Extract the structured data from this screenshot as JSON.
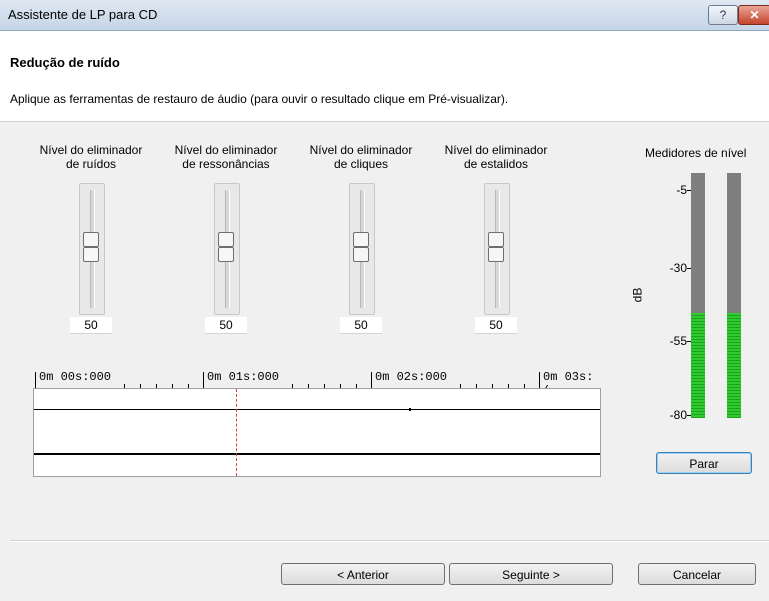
{
  "window": {
    "title": "Assistente de LP para CD",
    "help_label": "?",
    "close_label": "✕"
  },
  "header": {
    "heading": "Redução de ruído",
    "description": "Aplique as ferramentas de restauro de áudio (para ouvir o resultado clique em Pré-visualizar)."
  },
  "sliders": [
    {
      "label_line1": "Nível do eliminador",
      "label_line2": "de ruídos",
      "value": "50"
    },
    {
      "label_line1": "Nível do eliminador",
      "label_line2": "de ressonâncias",
      "value": "50"
    },
    {
      "label_line1": "Nível do eliminador",
      "label_line2": "de cliques",
      "value": "50"
    },
    {
      "label_line1": "Nível do eliminador",
      "label_line2": "de estalidos",
      "value": "50"
    }
  ],
  "timeline": {
    "ticks": [
      "0m 00s:000",
      "0m 01s:000",
      "0m 02s:000",
      "0m 03s:("
    ],
    "cursor_seconds": 1.0
  },
  "meters": {
    "title": "Medidores de nível",
    "unit": "dB",
    "scale": [
      "-5",
      "-30",
      "-55",
      "-80"
    ],
    "left_level_fraction": 0.43,
    "right_level_fraction": 0.43,
    "colors": {
      "empty": "#7f7f7f",
      "fill": "#2fcc2f"
    }
  },
  "buttons": {
    "stop": "Parar",
    "previous": "< Anterior",
    "next": "Seguinte >",
    "cancel": "Cancelar"
  }
}
